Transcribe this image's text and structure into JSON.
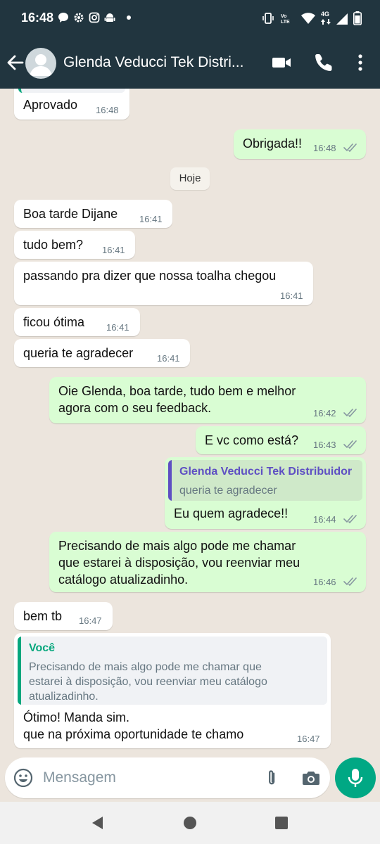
{
  "status_bar": {
    "time": "16:48",
    "network_label": "4G"
  },
  "header": {
    "contact_name": "Glenda Veducci Tek Distri..."
  },
  "messages": [
    {
      "dir": "in",
      "text": "Aprovado",
      "time": "16:48"
    },
    {
      "dir": "out",
      "text": "Obrigada!!",
      "time": "16:48",
      "status": "read"
    },
    {
      "dir": "in",
      "text": "Boa tarde Dijane",
      "time": "16:41"
    },
    {
      "dir": "in",
      "text": "tudo bem?",
      "time": "16:41"
    },
    {
      "dir": "in",
      "text": "passando pra dizer que nossa toalha chegou",
      "time": "16:41"
    },
    {
      "dir": "in",
      "text": "ficou ótima",
      "time": "16:41"
    },
    {
      "dir": "in",
      "text": "queria te agradecer",
      "time": "16:41"
    },
    {
      "dir": "out",
      "lines": [
        "Oie Glenda, boa tarde, tudo bem e melhor",
        "agora com o seu feedback."
      ],
      "time": "16:42",
      "status": "read"
    },
    {
      "dir": "out",
      "text": "E vc como está?",
      "time": "16:43",
      "status": "read"
    },
    {
      "dir": "out",
      "quote_name": "Glenda Veducci Tek Distribuidor",
      "quote_text": "queria te agradecer",
      "text": "Eu quem agradece!!",
      "time": "16:44",
      "status": "read"
    },
    {
      "dir": "out",
      "lines": [
        "Precisando de mais algo pode me chamar",
        "que estarei à disposição, vou reenviar meu",
        "catálogo atualizadinho."
      ],
      "time": "16:46",
      "status": "read"
    },
    {
      "dir": "in",
      "text": "bem tb",
      "time": "16:47"
    },
    {
      "dir": "in",
      "quote_name": "Você",
      "quote_lines": [
        "Precisando de mais algo pode me chamar que",
        "estarei à disposição, vou reenviar meu catálogo",
        "atualizadinho."
      ],
      "lines": [
        "Ótimo! Manda sim.",
        "que na próxima oportunidade te chamo"
      ],
      "time": "16:47"
    }
  ],
  "day_separator": "Hoje",
  "composer": {
    "placeholder": "Mensagem"
  },
  "colors": {
    "header_bg": "#21353f",
    "chat_bg": "#ece5dd",
    "incoming_bubble": "#ffffff",
    "outgoing_bubble": "#d9fdd3",
    "accent_green": "#00a884",
    "read_ticks": "#8696a0",
    "quote_purple": "#5e4fc3",
    "quote_green": "#06a77d"
  },
  "icons": [
    "back-arrow-icon",
    "avatar-placeholder-icon",
    "video-call-icon",
    "phone-icon",
    "more-vert-icon",
    "emoji-icon",
    "attach-icon",
    "camera-icon",
    "mic-icon",
    "nav-back-icon",
    "nav-home-icon",
    "nav-recents-icon"
  ]
}
